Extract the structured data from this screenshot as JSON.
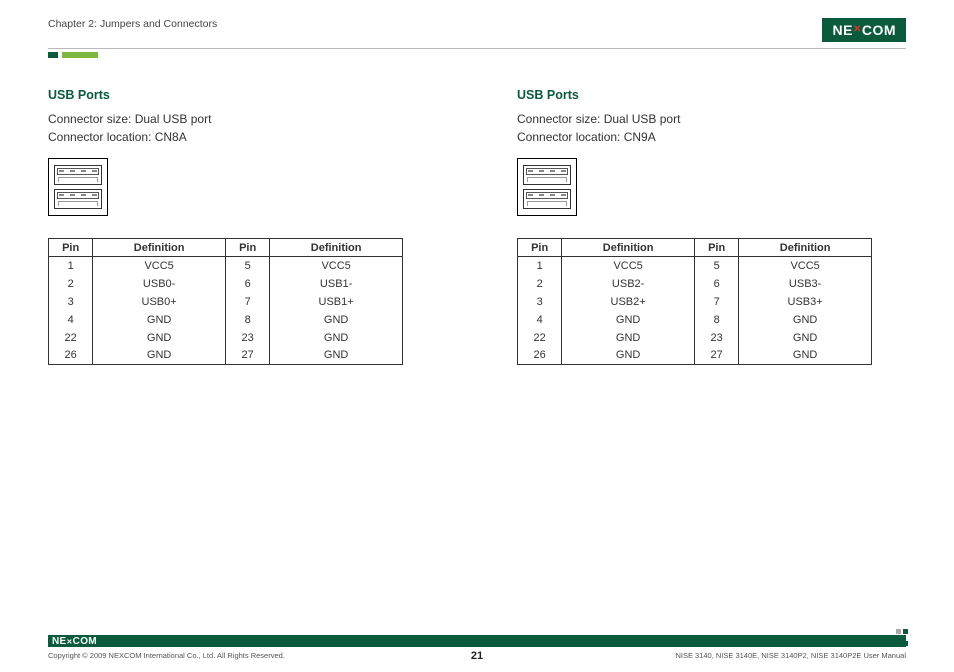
{
  "header": {
    "chapter": "Chapter 2: Jumpers and Connectors",
    "logo_text_left": "NE",
    "logo_text_right": "COM"
  },
  "columns": [
    {
      "title": "USB Ports",
      "size_label": "Connector size: Dual USB port",
      "location_label": "Connector location: CN8A",
      "table": {
        "headers": [
          "Pin",
          "Definition",
          "Pin",
          "Definition"
        ],
        "rows": [
          [
            "1",
            "VCC5",
            "5",
            "VCC5"
          ],
          [
            "2",
            "USB0-",
            "6",
            "USB1-"
          ],
          [
            "3",
            "USB0+",
            "7",
            "USB1+"
          ],
          [
            "4",
            "GND",
            "8",
            "GND"
          ],
          [
            "22",
            "GND",
            "23",
            "GND"
          ],
          [
            "26",
            "GND",
            "27",
            "GND"
          ]
        ]
      }
    },
    {
      "title": "USB Ports",
      "size_label": "Connector size: Dual USB port",
      "location_label": "Connector location: CN9A",
      "table": {
        "headers": [
          "Pin",
          "Definition",
          "Pin",
          "Definition"
        ],
        "rows": [
          [
            "1",
            "VCC5",
            "5",
            "VCC5"
          ],
          [
            "2",
            "USB2-",
            "6",
            "USB3-"
          ],
          [
            "3",
            "USB2+",
            "7",
            "USB3+"
          ],
          [
            "4",
            "GND",
            "8",
            "GND"
          ],
          [
            "22",
            "GND",
            "23",
            "GND"
          ],
          [
            "26",
            "GND",
            "27",
            "GND"
          ]
        ]
      }
    }
  ],
  "footer": {
    "logo_text_left": "NE",
    "logo_text_right": "COM",
    "copyright": "Copyright © 2009 NEXCOM International Co., Ltd. All Rights Reserved.",
    "page_number": "21",
    "manual": "NISE 3140, NISE 3140E, NISE 3140P2, NISE 3140P2E User Manual"
  }
}
